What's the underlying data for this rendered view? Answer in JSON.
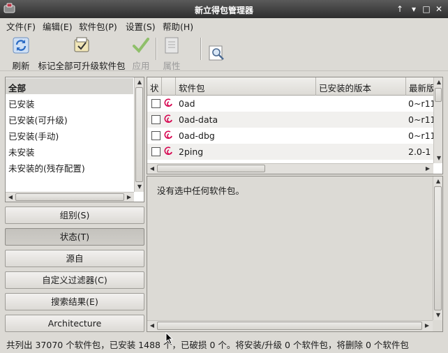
{
  "window": {
    "title": "新立得包管理器"
  },
  "menubar": {
    "items": [
      "文件(F)",
      "编辑(E)",
      "软件包(P)",
      "设置(S)",
      "帮助(H)"
    ]
  },
  "toolbar": {
    "refresh": "刷新",
    "mark_all_upgrades": "标记全部可升级软件包",
    "apply": "应用",
    "properties": "属性"
  },
  "filters": {
    "items": [
      "全部",
      "已安装",
      "已安装(可升级)",
      "已安装(手动)",
      "未安装",
      "未安装的(残存配置)"
    ],
    "selected": 0
  },
  "group_buttons": [
    "组别(S)",
    "状态(T)",
    "源自",
    "自定义过滤器(C)",
    "搜索结果(E)",
    "Architecture"
  ],
  "package_table": {
    "columns": [
      "状",
      "",
      "软件包",
      "已安装的版本",
      "最新版"
    ],
    "rows": [
      {
        "name": "0ad",
        "latest": "0~r11"
      },
      {
        "name": "0ad-data",
        "latest": "0~r11"
      },
      {
        "name": "0ad-dbg",
        "latest": "0~r11"
      },
      {
        "name": "2ping",
        "latest": "2.0-1"
      }
    ]
  },
  "description": {
    "text": "没有选中任何软件包。"
  },
  "statusbar": {
    "text": "共列出 37070 个软件包，已安装 1488 个，已破损 0 个。将安装/升级 0 个软件包，将删除 0 个软件包"
  },
  "colors": {
    "titlebar": "#3c3c3c",
    "debian_red": "#d70751",
    "apply_green": "#5aa02c"
  }
}
